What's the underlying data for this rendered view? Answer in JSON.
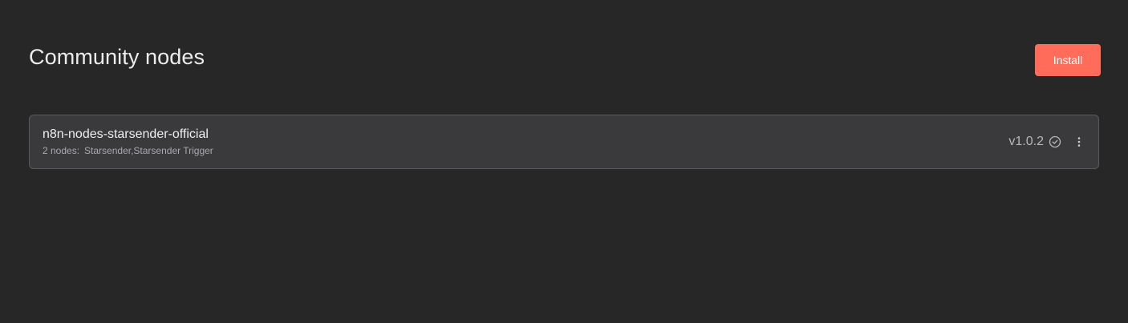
{
  "header": {
    "title": "Community nodes",
    "install_label": "Install"
  },
  "packages": [
    {
      "name": "n8n-nodes-starsender-official",
      "node_count_label": "2 nodes:",
      "node_names": "Starsender,Starsender Trigger",
      "version": "v1.0.2",
      "status_icon": "check-circle-icon",
      "menu_icon": "vertical-dots-icon"
    }
  ],
  "colors": {
    "background": "#272727",
    "card_background": "#3a3a3d",
    "card_border": "#5a5a5e",
    "accent": "#ff6d5a"
  }
}
